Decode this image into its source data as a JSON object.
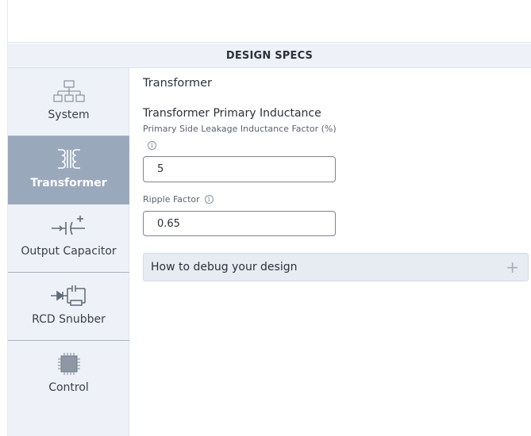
{
  "header": {
    "title": "DESIGN SPECS"
  },
  "sidebar": {
    "items": [
      {
        "label": "System",
        "icon": "hierarchy-icon",
        "active": false
      },
      {
        "label": "Transformer",
        "icon": "transformer-icon",
        "active": true
      },
      {
        "label": "Output Capacitor",
        "icon": "capacitor-icon",
        "active": false
      },
      {
        "label": "RCD Snubber",
        "icon": "rcd-snubber-icon",
        "active": false
      },
      {
        "label": "Control",
        "icon": "chip-icon",
        "active": false
      }
    ]
  },
  "main": {
    "section_title": "Transformer",
    "primary_inductance": {
      "title": "Transformer Primary Inductance",
      "leakage_label": "Primary Side Leakage Inductance Factor (%)",
      "leakage_value": "5"
    },
    "ripple": {
      "label": "Ripple Factor",
      "value": "0.65"
    },
    "accordion": {
      "label": "How to debug your design"
    }
  },
  "colors": {
    "active_nav": "#9aa8bc",
    "sidebar_bg": "#eef2f8",
    "accordion_bg": "#e7ecf3"
  }
}
